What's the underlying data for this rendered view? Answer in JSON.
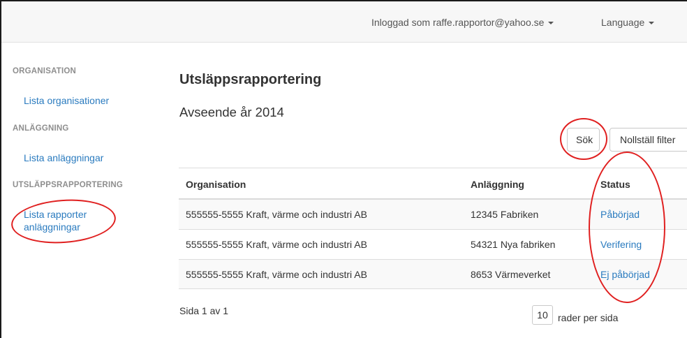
{
  "topbar": {
    "user_label": "Inloggad som raffe.rapportor@yahoo.se",
    "language_label": "Language"
  },
  "sidebar": {
    "sections": [
      {
        "heading": "ORGANISATION",
        "links": [
          "Lista organisationer"
        ]
      },
      {
        "heading": "ANLÄGGNING",
        "links": [
          "Lista anläggningar"
        ]
      },
      {
        "heading": "UTSLÄPPSRAPPORTERING",
        "links": [
          "Lista rapporter",
          "anläggningar"
        ]
      }
    ]
  },
  "main": {
    "title": "Utsläppsrapportering",
    "subtitle": "Avseende år 2014",
    "search_button": "Sök",
    "reset_button": "Nollställ filter"
  },
  "table": {
    "columns": [
      "Organisation",
      "Anläggning",
      "Status"
    ],
    "rows": [
      [
        "555555-5555 Kraft, värme och industri AB",
        "12345 Fabriken",
        "Påbörjad"
      ],
      [
        "555555-5555 Kraft, värme och industri AB",
        "54321 Nya fabriken",
        "Verifering"
      ],
      [
        "555555-5555 Kraft, värme och industri AB",
        "8653 Värmeverket",
        "Ej påbörjad"
      ]
    ]
  },
  "pagination": {
    "page_text": "Sida 1 av 1",
    "rows_per_page": "10",
    "rows_per_page_label": "rader per sida"
  },
  "colors": {
    "link": "#2a7bbf",
    "annotation": "#e02020"
  }
}
